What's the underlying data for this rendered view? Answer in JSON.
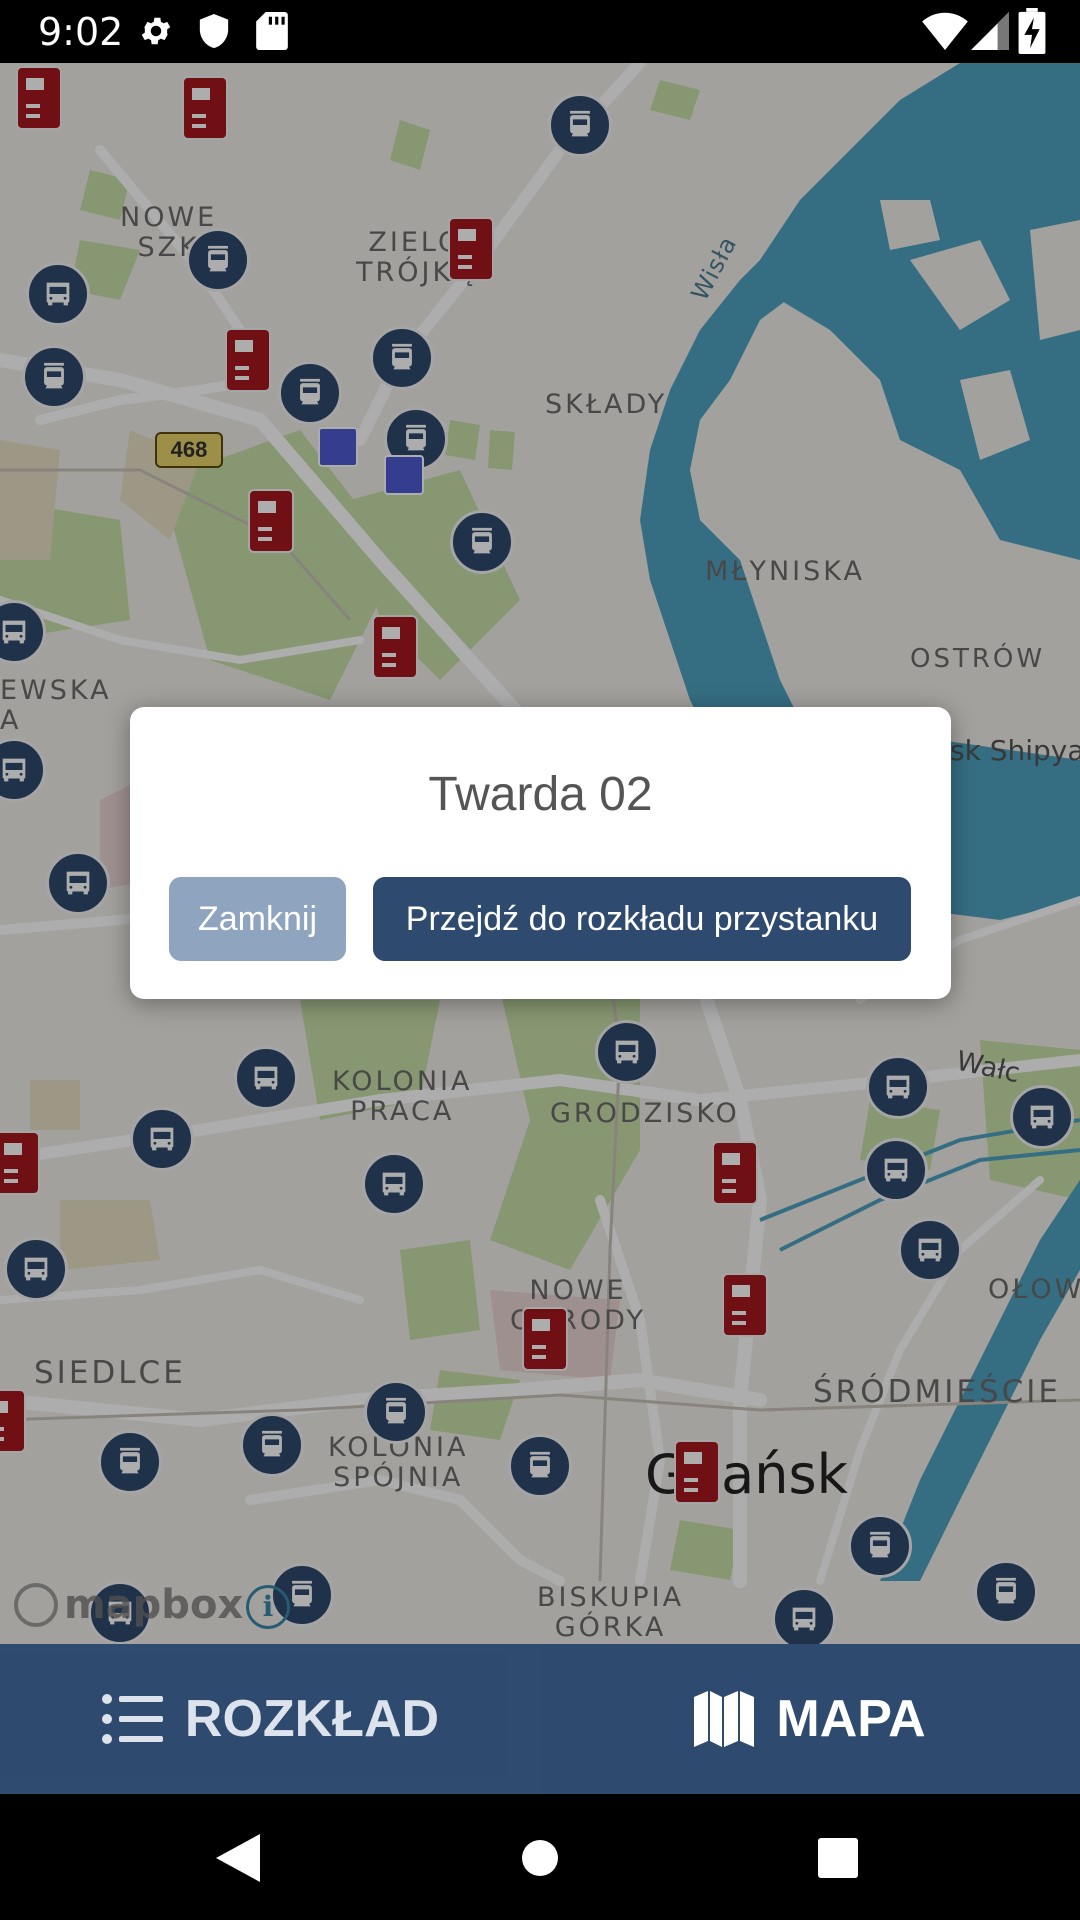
{
  "status_bar": {
    "time": "9:02"
  },
  "map": {
    "road_number": "468",
    "district_labels": [
      "NOWE\nSZK",
      "ZIELO\nTRÓJKĄ",
      "SKŁADY",
      "MŁYNISKA",
      "OSTRÓW",
      "EWSKA\nA",
      "KOLONIA\nPRACA",
      "GRODZISKO",
      "NOWE\nOGRODY",
      "SIEDLCE",
      "KOLONIA\nSPÓJNIA",
      "BISKUPIA\nGÓRKA",
      "ŚRÓDMIEŚCIE",
      "OŁOW"
    ],
    "water_labels": [
      "Wisła"
    ],
    "poi_label": "sk Shipya",
    "street_label": "Wałc",
    "city_label": "Gdańsk",
    "attribution": "mapbox",
    "info_glyph": "i"
  },
  "dialog": {
    "title": "Twarda 02",
    "close_label": "Zamknij",
    "go_label": "Przejdź do rozkładu przystanku"
  },
  "bottom_nav": {
    "tabs": [
      {
        "label": "ROZKŁAD",
        "icon": "list-icon",
        "active": false
      },
      {
        "label": "MAPA",
        "icon": "map-icon",
        "active": true
      }
    ]
  },
  "colors": {
    "primary": "#2e4a6e",
    "secondary_button": "#8ea4bf",
    "ticket_machine": "#a6191e",
    "water": "#4fa3c2"
  }
}
